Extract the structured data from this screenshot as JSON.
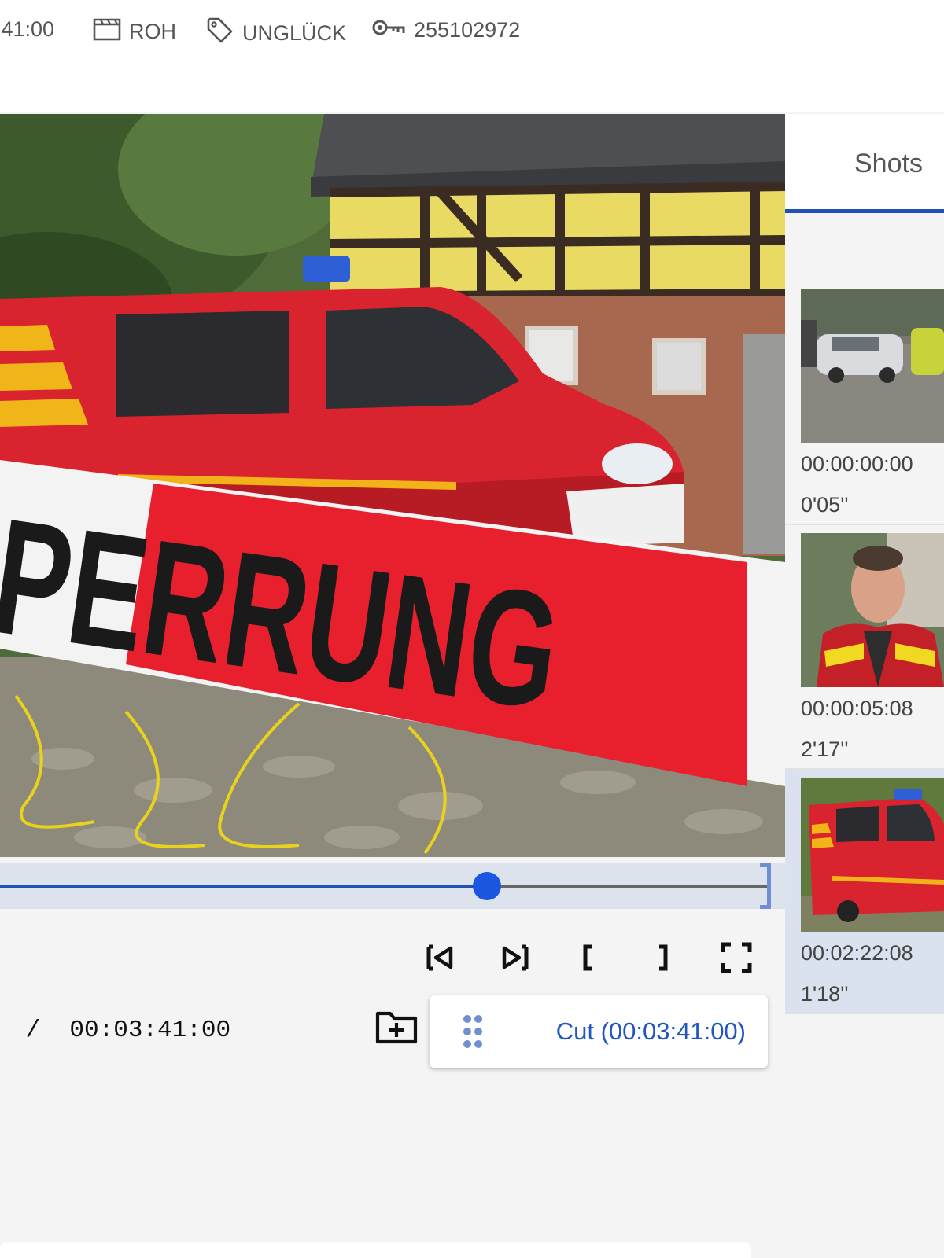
{
  "meta": {
    "duration": ":41:00",
    "type_label": "ROH",
    "tag_label": "UNGLÜCK",
    "id_label": "255102972",
    "icons": [
      "clapperboard-icon",
      "tag-icon",
      "key-icon"
    ]
  },
  "video": {
    "frame_text": "PERRUNG",
    "tape_color": "#e8202e",
    "van_color": "#d9232e"
  },
  "timeline": {
    "progress_fraction": 0.634,
    "accent": "#1f50b5"
  },
  "controls": {
    "timecode": " /  00:03:41:00",
    "cut_label": "Cut (00:03:41:00)",
    "icons": [
      "skip-to-start-icon",
      "skip-to-end-icon",
      "mark-in-icon",
      "mark-out-icon",
      "fullscreen-icon",
      "add-folder-icon",
      "drag-handle-icon"
    ]
  },
  "shots_panel": {
    "tab_label": "Shots",
    "items": [
      {
        "timecode": "00:00:00:00",
        "duration": "0'05''",
        "selected": false
      },
      {
        "timecode": "00:00:05:08",
        "duration": "2'17''",
        "selected": false
      },
      {
        "timecode": "00:02:22:08",
        "duration": "1'18''",
        "selected": true
      }
    ]
  }
}
